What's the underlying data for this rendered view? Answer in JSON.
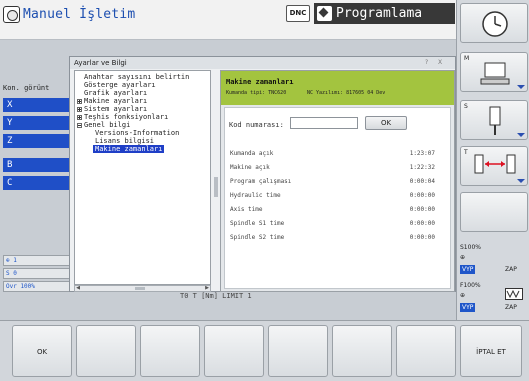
{
  "header": {
    "mode_left": "Manuel İşletim",
    "dnc_label": "DNC",
    "mode_right": "Programlama"
  },
  "left_panel": {
    "label": "Kon. görünt",
    "axes": [
      "X",
      "Y",
      "Z",
      "B",
      "C"
    ],
    "status": [
      "1",
      "S 0",
      "Ovr 100%"
    ]
  },
  "dialog": {
    "title": "Ayarlar ve Bilgi",
    "controls": [
      "?",
      "X"
    ],
    "tree": [
      {
        "label": "Anahtar sayısını belirtin",
        "expander": ""
      },
      {
        "label": "Gösterge ayarları",
        "expander": ""
      },
      {
        "label": "Grafik ayarları",
        "expander": ""
      },
      {
        "label": "Makine ayarları",
        "expander": "plus"
      },
      {
        "label": "Sistem ayarları",
        "expander": "plus"
      },
      {
        "label": "Teşhis fonksiyonları",
        "expander": "plus"
      },
      {
        "label": "Genel bilgi",
        "expander": "minus"
      },
      {
        "label": "Versions-Information",
        "expander": ""
      },
      {
        "label": "Lisans bilgisi",
        "expander": ""
      },
      {
        "label": "Makine zamanları",
        "expander": "",
        "selected": true
      }
    ],
    "content": {
      "title": "Makine zamanları",
      "control_type_label": "Kumanda tipi: TNC620",
      "software_label": "NC Yazılımı: 817605 04 Dev",
      "code_label": "Kod numarası:",
      "code_value": "",
      "ok_label": "OK",
      "rows": [
        {
          "label": "Kumanda açık",
          "value": "1:23:07"
        },
        {
          "label": "Makine açık",
          "value": "1:22:32"
        },
        {
          "label": "Program çalışması",
          "value": "0:00:04"
        },
        {
          "label": "Hydraulic time",
          "value": "0:00:00"
        },
        {
          "label": "Axis time",
          "value": "0:00:00"
        },
        {
          "label": "Spindle S1 time",
          "value": "0:00:00"
        },
        {
          "label": "Spindle S2 time",
          "value": "0:00:00"
        }
      ]
    }
  },
  "behind_text": "T0 T   [Nm]   LIMIT 1",
  "right_column": {
    "keys": [
      {
        "label": "",
        "icon": "clock-icon"
      },
      {
        "label": "M",
        "icon": "machine-icon"
      },
      {
        "label": "S",
        "icon": "spindle-icon"
      },
      {
        "label": "T",
        "icon": "tool-change-icon"
      },
      {
        "label": "",
        "icon": ""
      }
    ],
    "s_override": "S100%",
    "f_override": "F100%",
    "vyp": "VYP",
    "zap": "ZAP"
  },
  "softkeys": [
    "OK",
    "",
    "",
    "",
    "",
    "",
    "",
    "İPTAL ET"
  ],
  "colors": {
    "accent_blue": "#1f4fc7",
    "header_green": "#a3c43f",
    "mode_blue_text": "#1d4fb0"
  }
}
